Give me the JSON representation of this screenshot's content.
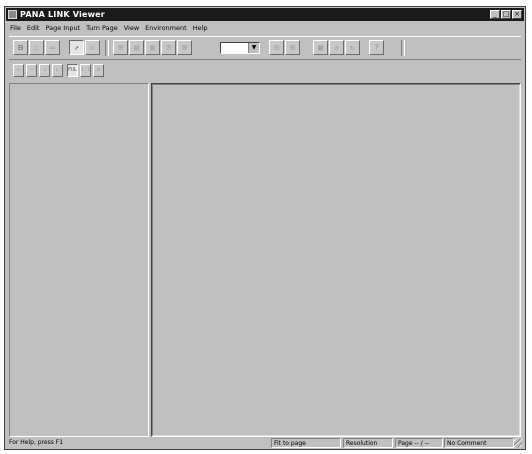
{
  "window": {
    "title": "PANA LINK Viewer"
  },
  "title_controls": [
    "_",
    "□",
    "×"
  ],
  "menu": [
    "File",
    "Edit",
    "Page Input",
    "Turn Page",
    "View",
    "Environment",
    "Help"
  ],
  "toolbar1": [
    "⊟",
    "○",
    "▭",
    "↗",
    "▫",
    "⊞",
    "▤",
    "▥",
    "⊡",
    "⊠",
    "⊟",
    "⊞",
    "▦",
    "↺",
    "↻",
    "?"
  ],
  "toolbar2": [
    "⇦",
    "⇨",
    "◁",
    "▷",
    "FUL",
    "1:1",
    "⊡"
  ],
  "zoom_combo": {
    "value": ""
  },
  "status": {
    "help": "For Help, press F1",
    "fit": "Fit to page",
    "resolution": "Resolution",
    "page": "Page -- / --",
    "comment": "No Comment"
  }
}
